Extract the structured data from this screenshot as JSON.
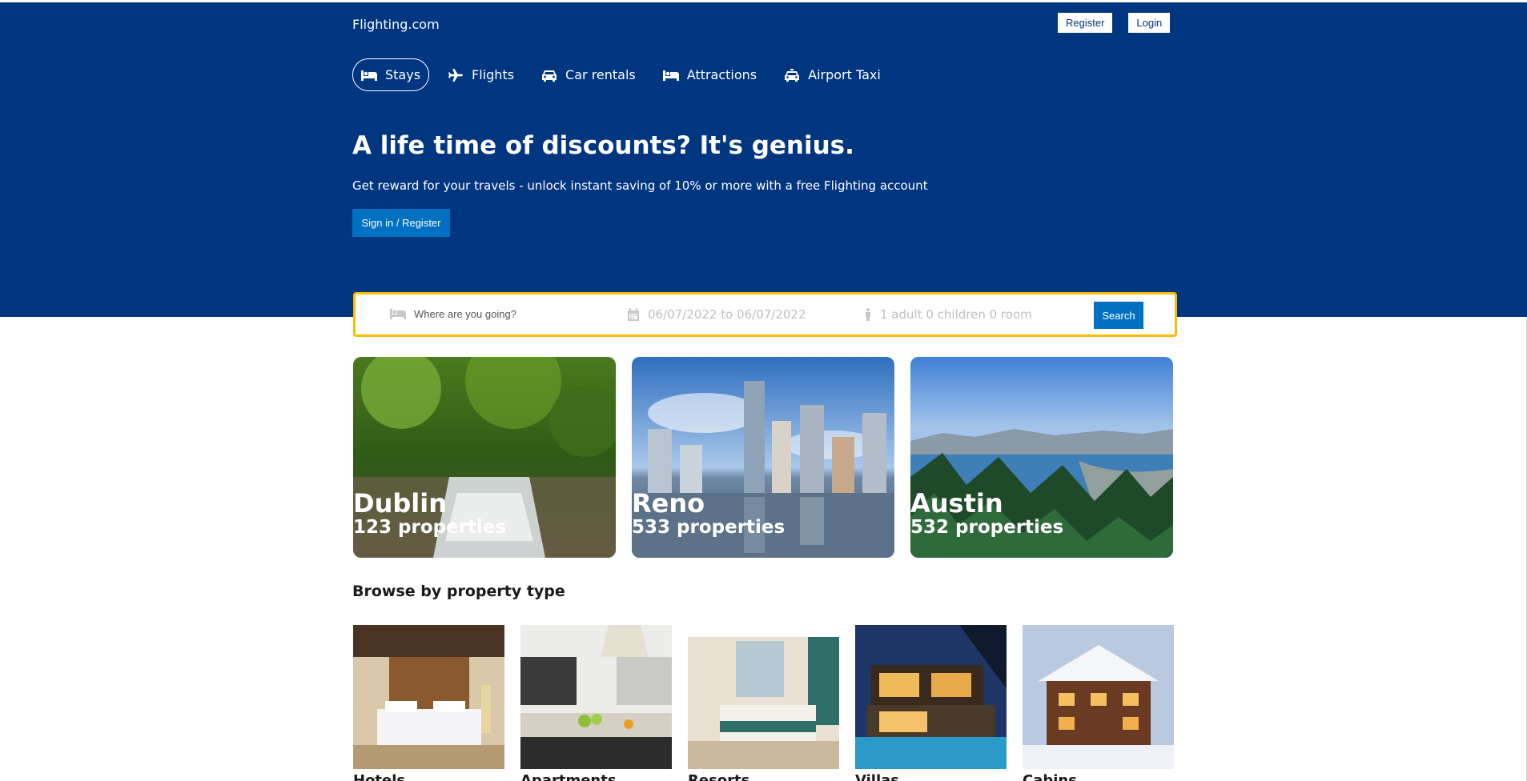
{
  "header": {
    "brand": "Flighting.com",
    "register_label": "Register",
    "login_label": "Login",
    "tabs": [
      {
        "label": "Stays",
        "icon": "bed-icon",
        "active": true
      },
      {
        "label": "Flights",
        "icon": "plane-icon",
        "active": false
      },
      {
        "label": "Car rentals",
        "icon": "car-icon",
        "active": false
      },
      {
        "label": "Attractions",
        "icon": "bed-icon",
        "active": false
      },
      {
        "label": "Airport Taxi",
        "icon": "taxi-icon",
        "active": false
      }
    ],
    "headline": "A life time of discounts? It's genius.",
    "subline": "Get reward for your travels - unlock instant saving of 10% or more with a free Flighting account",
    "cta_label": "Sign in / Register"
  },
  "search": {
    "destination_placeholder": "Where are you going?",
    "dates": "06/07/2022 to 06/07/2022",
    "guests": "1 adult 0 children 0 room",
    "search_label": "Search"
  },
  "featured": [
    {
      "city": "Dublin",
      "properties": "123 properties"
    },
    {
      "city": "Reno",
      "properties": "533 properties"
    },
    {
      "city": "Austin",
      "properties": "532 properties"
    }
  ],
  "browse": {
    "title": "Browse by property type",
    "types": [
      {
        "label": "Hotels"
      },
      {
        "label": "Apartments"
      },
      {
        "label": "Resorts"
      },
      {
        "label": "Villas"
      },
      {
        "label": "Cabins"
      }
    ]
  },
  "colors": {
    "header_bg": "#003580",
    "accent_button": "#0071c2",
    "search_border": "#febb02"
  }
}
